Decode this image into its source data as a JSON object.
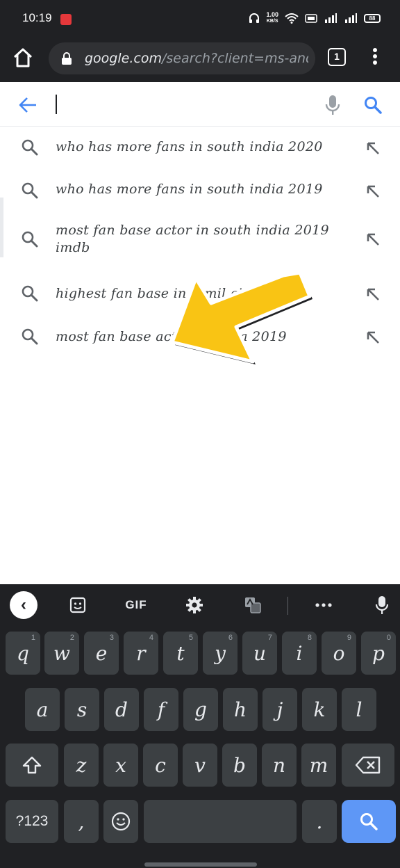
{
  "status_bar": {
    "time": "10:19",
    "speed_value": "1.00",
    "speed_unit": "KB/S",
    "battery": "88"
  },
  "url_bar": {
    "domain": "google.com",
    "path": "/search?client=ms-and",
    "tab_count": "1"
  },
  "search": {
    "value": "",
    "placeholder": ""
  },
  "suggestions": [
    {
      "text": "who has more fans in south india 2020"
    },
    {
      "text": "who has more fans in south india 2019"
    },
    {
      "text": "most fan base actor in south india 2019 imdb"
    },
    {
      "text": "highest fan base in tamil cinema"
    },
    {
      "text": "most fan base actor in india 2019"
    }
  ],
  "keyboard": {
    "toolbar": {
      "gif_label": "GIF"
    },
    "row1": [
      {
        "key": "q",
        "hint": "1"
      },
      {
        "key": "w",
        "hint": "2"
      },
      {
        "key": "e",
        "hint": "3"
      },
      {
        "key": "r",
        "hint": "4"
      },
      {
        "key": "t",
        "hint": "5"
      },
      {
        "key": "y",
        "hint": "6"
      },
      {
        "key": "u",
        "hint": "7"
      },
      {
        "key": "i",
        "hint": "8"
      },
      {
        "key": "o",
        "hint": "9"
      },
      {
        "key": "p",
        "hint": "0"
      }
    ],
    "row2": [
      "a",
      "s",
      "d",
      "f",
      "g",
      "h",
      "j",
      "k",
      "l"
    ],
    "row3": [
      "z",
      "x",
      "c",
      "v",
      "b",
      "n",
      "m"
    ],
    "symbols_label": "?123",
    "comma": ",",
    "period": "."
  },
  "colors": {
    "chrome_dark": "#202124",
    "accent_blue": "#4285f4",
    "arrow_yellow": "#f9c414"
  }
}
